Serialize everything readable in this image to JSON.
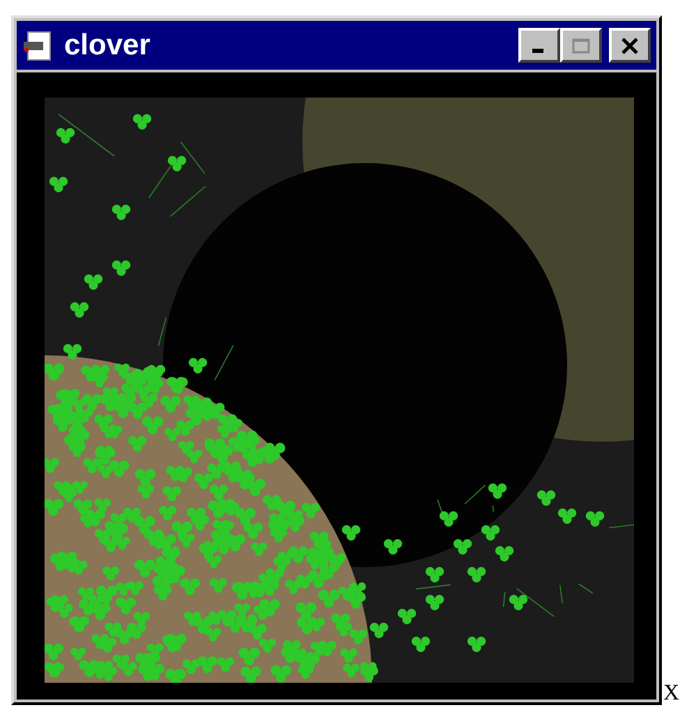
{
  "window": {
    "title": "clover",
    "buttons": [
      {
        "kind": "minimize",
        "disabled": false
      },
      {
        "kind": "maximize",
        "disabled": true
      },
      {
        "kind": "close",
        "disabled": false
      }
    ]
  },
  "corner_mark": "X"
}
